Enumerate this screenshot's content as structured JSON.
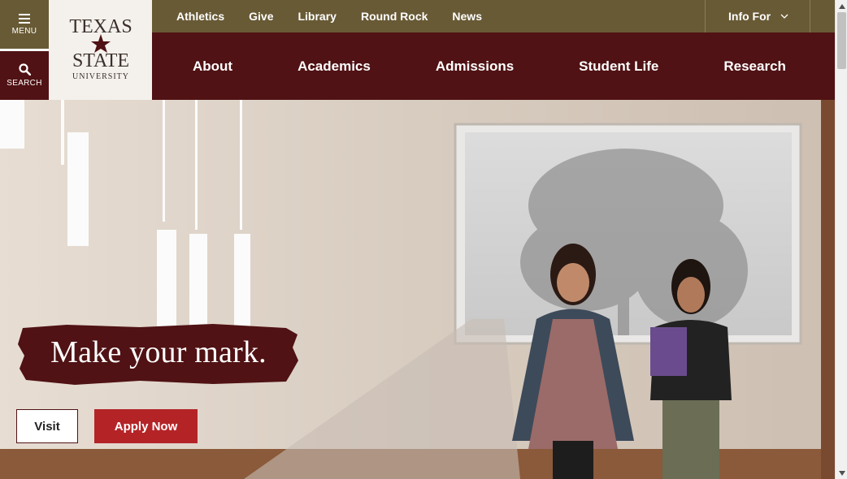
{
  "left_rail": {
    "menu_label": "MENU",
    "menu_icon": "hamburger-icon",
    "search_label": "SEARCH",
    "search_icon": "search-icon"
  },
  "logo": {
    "line1": "TEXAS",
    "line2": "STATE",
    "line3": "UNIVERSITY",
    "icon": "star-icon"
  },
  "utility_nav": {
    "links": [
      "Athletics",
      "Give",
      "Library",
      "Round Rock",
      "News"
    ],
    "info_for_label": "Info For",
    "info_for_icon": "chevron-down-icon"
  },
  "main_nav": {
    "links": [
      "About",
      "Academics",
      "Admissions",
      "Student Life",
      "Research"
    ]
  },
  "hero": {
    "tagline": "Make your mark.",
    "visit_label": "Visit",
    "apply_label": "Apply Now"
  },
  "colors": {
    "gold": "#685a35",
    "maroon": "#501214",
    "apply_red": "#b42427",
    "logo_bg": "#f4f1ec"
  }
}
